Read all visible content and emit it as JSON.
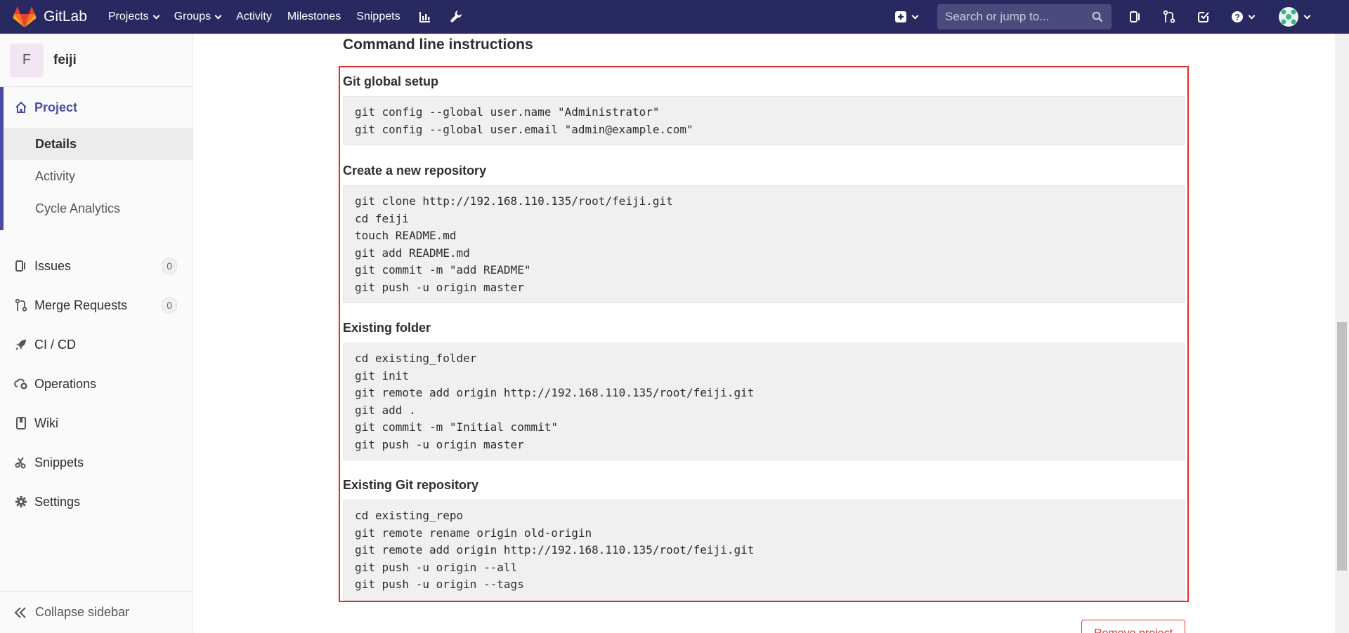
{
  "navbar": {
    "brand": "GitLab",
    "links": [
      {
        "label": "Projects",
        "dropdown": true
      },
      {
        "label": "Groups",
        "dropdown": true
      },
      {
        "label": "Activity",
        "dropdown": false
      },
      {
        "label": "Milestones",
        "dropdown": false
      },
      {
        "label": "Snippets",
        "dropdown": false
      }
    ],
    "search_placeholder": "Search or jump to...",
    "icons": [
      "chart-bar-icon",
      "wrench-icon",
      "plus-square-icon",
      "search-icon",
      "issues-icon",
      "merge-request-icon",
      "todo-check-icon",
      "help-icon",
      "user-avatar-icon"
    ]
  },
  "sidebar": {
    "avatar_letter": "F",
    "project_name": "feiji",
    "project_label": "Project",
    "sub_items": [
      "Details",
      "Activity",
      "Cycle Analytics"
    ],
    "items": [
      {
        "label": "Issues",
        "badge": "0",
        "icon": "issues-icon"
      },
      {
        "label": "Merge Requests",
        "badge": "0",
        "icon": "merge-request-icon"
      },
      {
        "label": "CI / CD",
        "icon": "rocket-icon"
      },
      {
        "label": "Operations",
        "icon": "cloud-gear-icon"
      },
      {
        "label": "Wiki",
        "icon": "book-icon"
      },
      {
        "label": "Snippets",
        "icon": "scissors-icon"
      },
      {
        "label": "Settings",
        "icon": "gear-icon"
      }
    ],
    "collapse_label": "Collapse sidebar"
  },
  "main": {
    "heading": "Command line instructions",
    "sections": [
      {
        "title": "Git global setup",
        "lines": [
          "git config --global user.name \"Administrator\"",
          "git config --global user.email \"admin@example.com\""
        ]
      },
      {
        "title": "Create a new repository",
        "lines": [
          "git clone http://192.168.110.135/root/feiji.git",
          "cd feiji",
          "touch README.md",
          "git add README.md",
          "git commit -m \"add README\"",
          "git push -u origin master"
        ]
      },
      {
        "title": "Existing folder",
        "lines": [
          "cd existing_folder",
          "git init",
          "git remote add origin http://192.168.110.135/root/feiji.git",
          "git add .",
          "git commit -m \"Initial commit\"",
          "git push -u origin master"
        ]
      },
      {
        "title": "Existing Git repository",
        "lines": [
          "cd existing_repo",
          "git remote rename origin old-origin",
          "git remote add origin http://192.168.110.135/root/feiji.git",
          "git push -u origin --all",
          "git push -u origin --tags"
        ]
      }
    ],
    "remove_button": "Remove project"
  },
  "colors": {
    "navbar_bg": "#292961",
    "sidebar_active_border": "#4b4ba3",
    "highlight_box": "#e52a2a",
    "danger": "#db3b21"
  }
}
